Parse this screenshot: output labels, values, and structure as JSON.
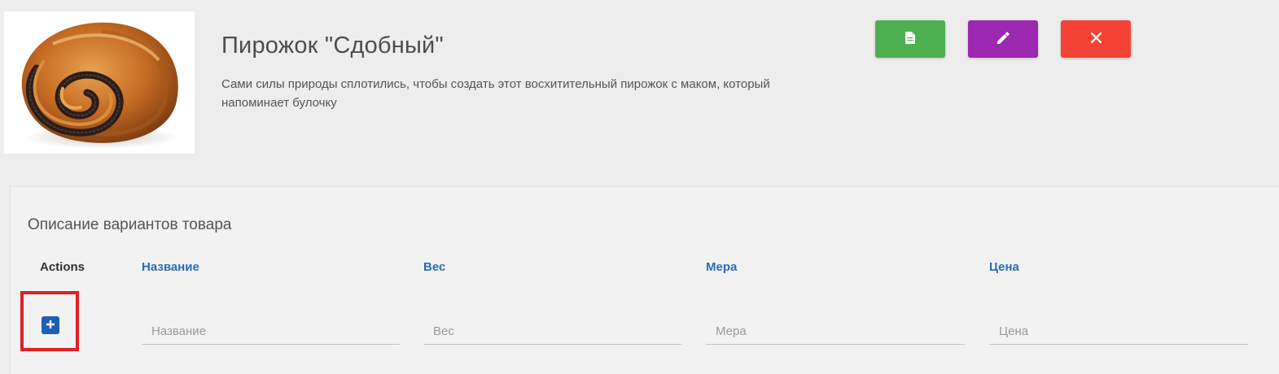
{
  "product": {
    "title": "Пирожок \"Сдобный\"",
    "description": "Сами силы природы сплотились, чтобы создать этот восхитительный пирожок с маком, который напоминает булочку"
  },
  "toolbar": {
    "doc_color": "#4caf50",
    "edit_color": "#9c27b0",
    "close_color": "#f44336"
  },
  "variants": {
    "title": "Описание вариантов товара",
    "headers": {
      "actions": "Actions",
      "name": "Название",
      "weight": "Вес",
      "measure": "Мера",
      "price": "Цена"
    },
    "inputs": {
      "name_placeholder": "Название",
      "weight_placeholder": "Вес",
      "measure_placeholder": "Мера",
      "price_placeholder": "Цена"
    }
  }
}
